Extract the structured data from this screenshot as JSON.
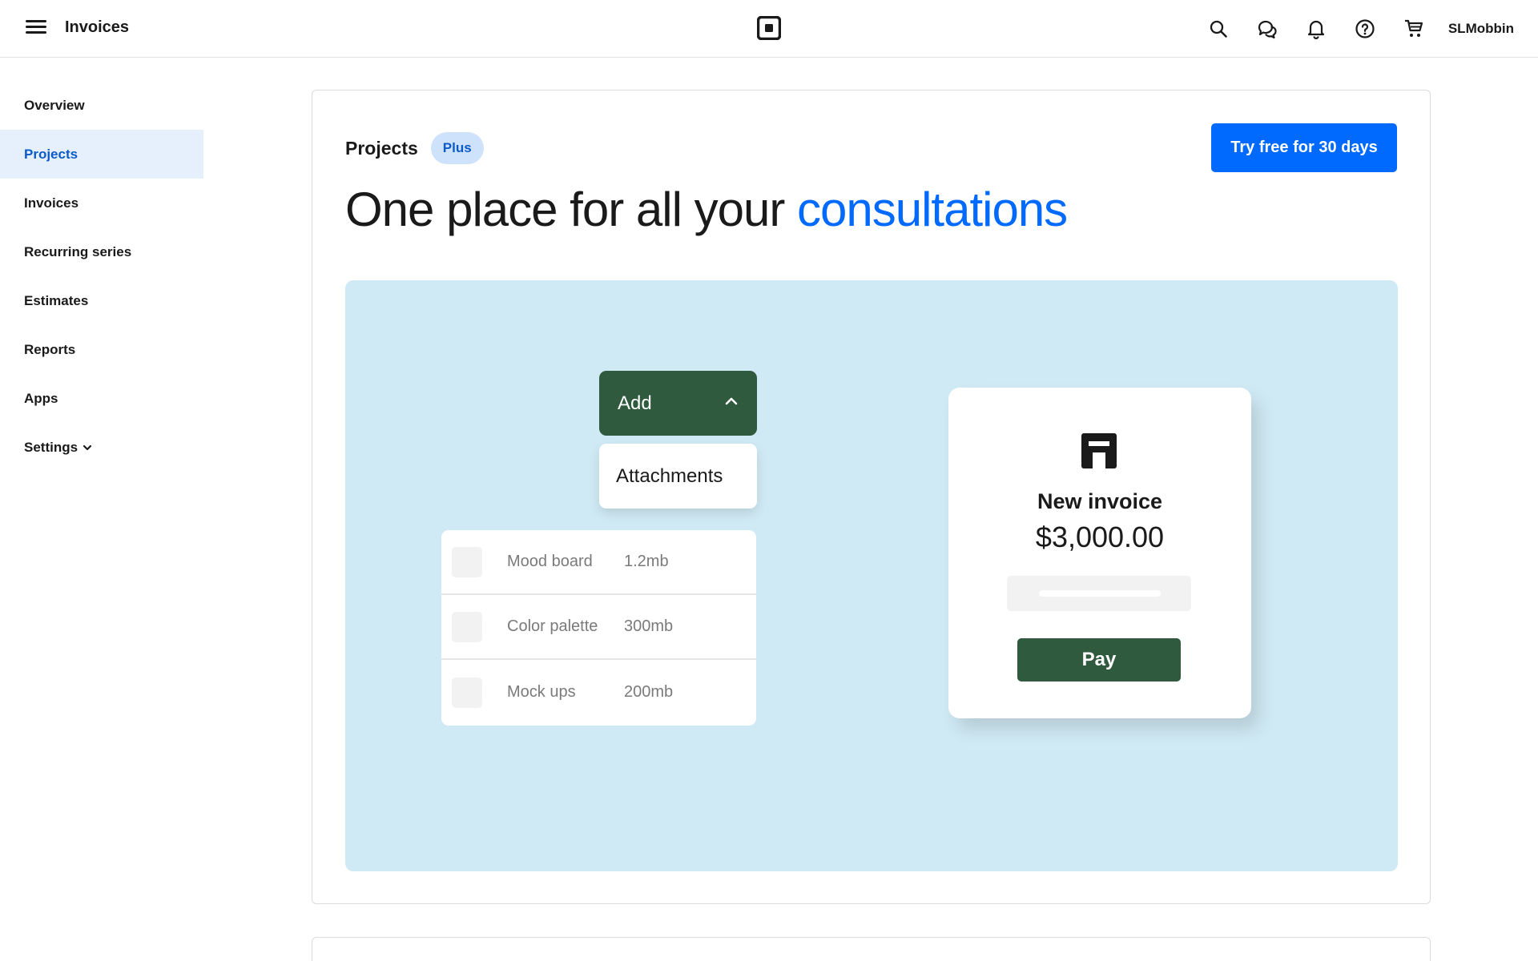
{
  "header": {
    "menu_icon": "hamburger-menu-icon",
    "title": "Invoices",
    "logo": "square-logo",
    "icons": [
      "search-icon",
      "messages-icon",
      "bell-icon",
      "help-icon",
      "cart-icon"
    ],
    "username": "SLMobbin"
  },
  "sidebar": {
    "items": [
      {
        "label": "Overview"
      },
      {
        "label": "Projects",
        "active": true
      },
      {
        "label": "Invoices"
      },
      {
        "label": "Recurring series"
      },
      {
        "label": "Estimates"
      },
      {
        "label": "Reports"
      },
      {
        "label": "Apps"
      },
      {
        "label": "Settings",
        "icon": "chevron-down-icon"
      }
    ]
  },
  "main": {
    "section_title": "Projects",
    "badge": "Plus",
    "cta_label": "Try free for 30 days",
    "headline_prefix": "One place for all your ",
    "headline_accent": "consultations",
    "colors": {
      "accent": "#006aff",
      "illustration_bg": "#d0eaf5",
      "dark_green": "#2f5a3e",
      "active_nav_bg": "#e6f0fd"
    }
  },
  "illustration": {
    "add_label": "Add",
    "add_icon": "chevron-up-icon",
    "attachments_label": "Attachments",
    "files": [
      {
        "name": "Mood board",
        "size": "1.2mb"
      },
      {
        "name": "Color palette",
        "size": "300mb"
      },
      {
        "name": "Mock ups",
        "size": "200mb"
      }
    ],
    "invoice": {
      "icon": "square-register-icon",
      "title": "New invoice",
      "amount": "$3,000.00",
      "pay_label": "Pay"
    }
  }
}
